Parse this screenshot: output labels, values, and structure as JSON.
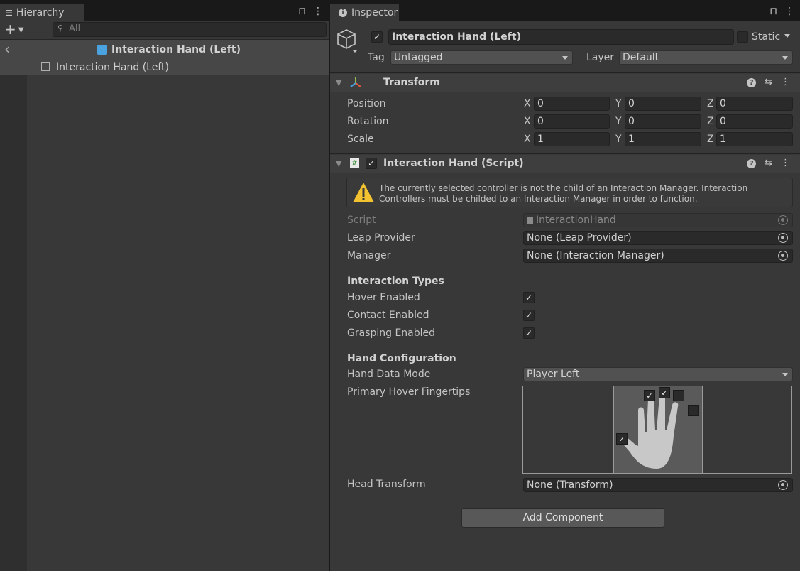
{
  "hierarchy": {
    "tab_label": "Hierarchy",
    "search_placeholder": "All",
    "scene_title": "Interaction Hand (Left)",
    "items": [
      {
        "label": "Interaction Hand (Left)"
      }
    ]
  },
  "inspector": {
    "tab_label": "Inspector",
    "object": {
      "active": true,
      "name": "Interaction Hand (Left)",
      "static_label": "Static",
      "static": false,
      "tag_label": "Tag",
      "tag_value": "Untagged",
      "layer_label": "Layer",
      "layer_value": "Default"
    },
    "transform": {
      "title": "Transform",
      "rows": [
        {
          "label": "Position",
          "x": "0",
          "y": "0",
          "z": "0"
        },
        {
          "label": "Rotation",
          "x": "0",
          "y": "0",
          "z": "0"
        },
        {
          "label": "Scale",
          "x": "1",
          "y": "1",
          "z": "1"
        }
      ],
      "axis_x": "X",
      "axis_y": "Y",
      "axis_z": "Z"
    },
    "script_component": {
      "title": "Interaction Hand (Script)",
      "enabled": true,
      "warning": "The currently selected controller is not the child of an Interaction Manager. Interaction Controllers must be childed to an Interaction Manager in order to function.",
      "script_label": "Script",
      "script_value": "InteractionHand",
      "leap_provider_label": "Leap Provider",
      "leap_provider_value": "None (Leap Provider)",
      "manager_label": "Manager",
      "manager_value": "None (Interaction Manager)",
      "interaction_types_header": "Interaction Types",
      "hover_label": "Hover Enabled",
      "hover_enabled": true,
      "contact_label": "Contact Enabled",
      "contact_enabled": true,
      "grasping_label": "Grasping Enabled",
      "grasping_enabled": true,
      "hand_config_header": "Hand Configuration",
      "hand_data_mode_label": "Hand Data Mode",
      "hand_data_mode_value": "Player Left",
      "fingertips_label": "Primary Hover Fingertips",
      "fingertips": {
        "thumb": true,
        "index": true,
        "middle": true,
        "ring": false,
        "pinky": false
      },
      "head_transform_label": "Head Transform",
      "head_transform_value": "None (Transform)"
    },
    "add_component_label": "Add Component"
  },
  "icons": {
    "check": "✓",
    "help": "?",
    "settings": "⇆",
    "more": "⋮",
    "lock": "🔓",
    "back": "‹",
    "plus": "+"
  },
  "colors": {
    "accent_blue": "#4aa3df",
    "warning_yellow": "#f2c230"
  }
}
